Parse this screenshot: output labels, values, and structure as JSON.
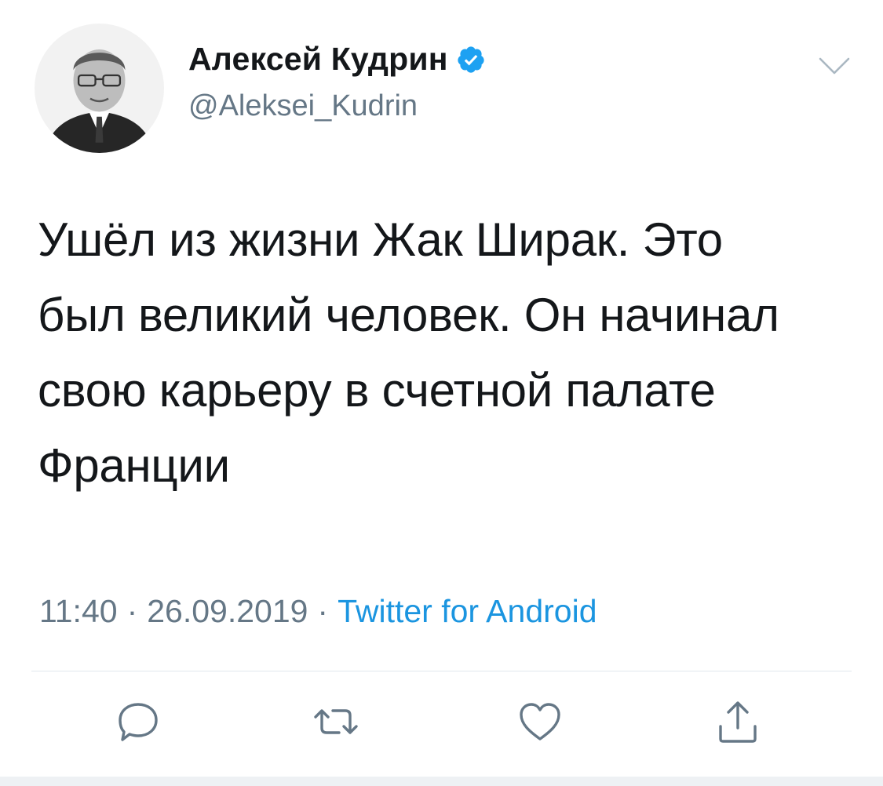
{
  "author": {
    "display_name": "Алексей Кудрин",
    "handle": "@Aleksei_Kudrin",
    "verified": true
  },
  "tweet": {
    "text": "Ушёл из жизни Жак Ширак. Это\nбыл великий человек. Он начинал\nсвою карьеру в счетной палате\nФранции"
  },
  "meta": {
    "time": "11:40",
    "separator": "·",
    "date": "26.09.2019",
    "source": "Twitter for Android"
  },
  "icons": {
    "verified": "verified-badge-icon",
    "more": "chevron-down-icon",
    "reply": "reply-icon",
    "retweet": "retweet-icon",
    "like": "heart-icon",
    "share": "share-icon"
  },
  "colors": {
    "text": "#14171a",
    "secondary": "#657786",
    "link": "#1b95e0",
    "verified": "#1da1f2",
    "icon": "#657786",
    "divider": "#e1e8ed"
  }
}
